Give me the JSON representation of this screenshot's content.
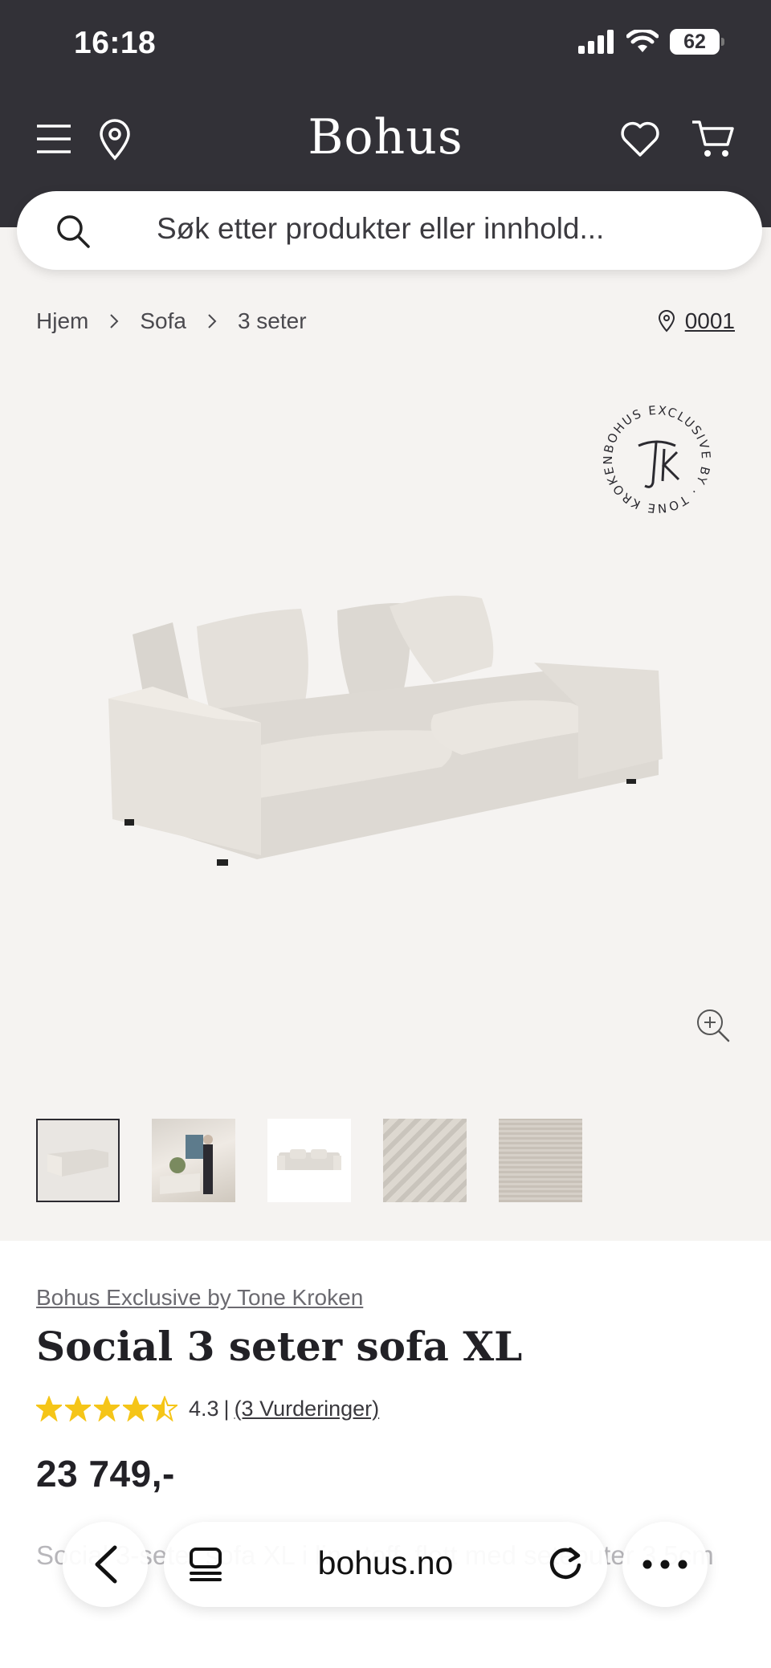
{
  "status_bar": {
    "time": "16:18",
    "battery": "62"
  },
  "header": {
    "logo": "Bohus"
  },
  "search": {
    "placeholder": "Søk etter produkter eller innhold..."
  },
  "breadcrumb": {
    "items": [
      "Hjem",
      "Sofa",
      "3 seter"
    ],
    "store": "0001"
  },
  "badge": {
    "text": "BOHUS EXCLUSIVE BY · TONE KROKEN ·"
  },
  "product": {
    "brand": "Bohus Exclusive by Tone Kroken",
    "title": "Social 3 seter sofa XL",
    "rating": 4.3,
    "rating_score": "4.3",
    "rating_separator": "|",
    "rating_count": "(3 Vurderinger)",
    "price": "23 749,-",
    "description": "Social 3-seter sofa XL i lin-stoff, flott med seteputer 3.5cm"
  },
  "thumbnails": [
    "sofa-front",
    "room-scene",
    "sofa-white",
    "fabric-fold",
    "fabric-texture"
  ],
  "browser": {
    "url": "bohus.no"
  },
  "colors": {
    "header_bg": "#323137",
    "page_bg": "#f5f3f1",
    "star": "#f5c518"
  }
}
